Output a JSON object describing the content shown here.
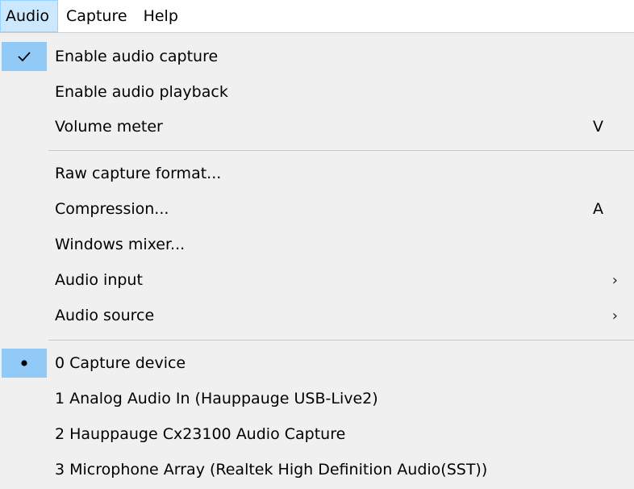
{
  "menubar": {
    "items": [
      {
        "label": "Audio",
        "active": true
      },
      {
        "label": "Capture",
        "active": false
      },
      {
        "label": "Help",
        "active": false
      }
    ]
  },
  "menu": {
    "sections": [
      {
        "items": [
          {
            "label": "Enable audio capture",
            "checked": true,
            "mark": "checkmark-icon",
            "shortcut": "",
            "submenu": false
          },
          {
            "label": "Enable audio playback",
            "checked": false,
            "mark": "",
            "shortcut": "",
            "submenu": false
          },
          {
            "label": "Volume meter",
            "checked": false,
            "mark": "",
            "shortcut": "V",
            "submenu": false
          }
        ]
      },
      {
        "items": [
          {
            "label": "Raw capture format...",
            "checked": false,
            "mark": "",
            "shortcut": "",
            "submenu": false
          },
          {
            "label": "Compression...",
            "checked": false,
            "mark": "",
            "shortcut": "A",
            "submenu": false
          },
          {
            "label": "Windows mixer...",
            "checked": false,
            "mark": "",
            "shortcut": "",
            "submenu": false
          },
          {
            "label": "Audio input",
            "checked": false,
            "mark": "",
            "shortcut": "",
            "submenu": true
          },
          {
            "label": "Audio source",
            "checked": false,
            "mark": "",
            "shortcut": "",
            "submenu": true
          }
        ]
      },
      {
        "items": [
          {
            "label": "0 Capture device",
            "checked": true,
            "mark": "bullet-icon",
            "shortcut": "",
            "submenu": false
          },
          {
            "label": "1 Analog Audio In (Hauppauge USB-Live2)",
            "checked": false,
            "mark": "",
            "shortcut": "",
            "submenu": false
          },
          {
            "label": "2 Hauppauge Cx23100 Audio Capture",
            "checked": false,
            "mark": "",
            "shortcut": "",
            "submenu": false
          },
          {
            "label": "3 Microphone Array (Realtek High Definition Audio(SST))",
            "checked": false,
            "mark": "",
            "shortcut": "",
            "submenu": false
          }
        ]
      }
    ],
    "submenu_glyph": "›"
  },
  "colors": {
    "menubar_bg": "#ffffff",
    "menu_bg": "#f0f0f0",
    "active_menubar": "#cce8ff",
    "checked_gutter": "#91c9f7",
    "separator": "#c8c8c8"
  }
}
